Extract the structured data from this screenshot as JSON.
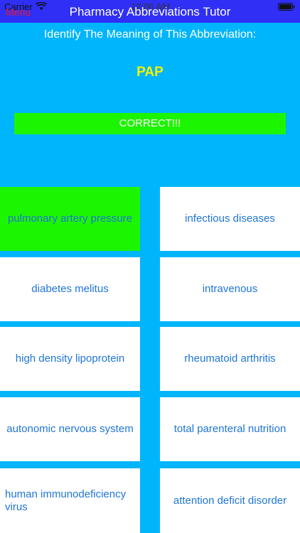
{
  "status_bar": {
    "carrier": "Carrier",
    "time": "12:06 AM"
  },
  "nav": {
    "menu_label": "Menu",
    "title": "Pharmacy Abbreviations Tutor"
  },
  "quiz": {
    "prompt": "Identify The Meaning of This Abbreviation:",
    "abbreviation": "PAP",
    "result": "CORRECT!!!"
  },
  "answers": [
    {
      "label": "pulmonary artery pressure",
      "state": "correct"
    },
    {
      "label": "infectious diseases",
      "state": "normal"
    },
    {
      "label": "diabetes melitus",
      "state": "normal"
    },
    {
      "label": "intravenous",
      "state": "normal"
    },
    {
      "label": "high density lipoprotein",
      "state": "normal"
    },
    {
      "label": "rheumatoid arthritis",
      "state": "normal"
    },
    {
      "label": "autonomic nervous system",
      "state": "normal"
    },
    {
      "label": "total parenteral nutrition",
      "state": "normal"
    },
    {
      "label": "human immunodeficiency virus",
      "state": "normal"
    },
    {
      "label": "attention deficit disorder",
      "state": "normal"
    }
  ],
  "colors": {
    "background": "#00b5fb",
    "nav_bar": "#2f2ff5",
    "correct": "#1cf500",
    "abbreviation": "#f4f400",
    "answer_text": "#1f75d6",
    "menu": "#e8182a"
  }
}
